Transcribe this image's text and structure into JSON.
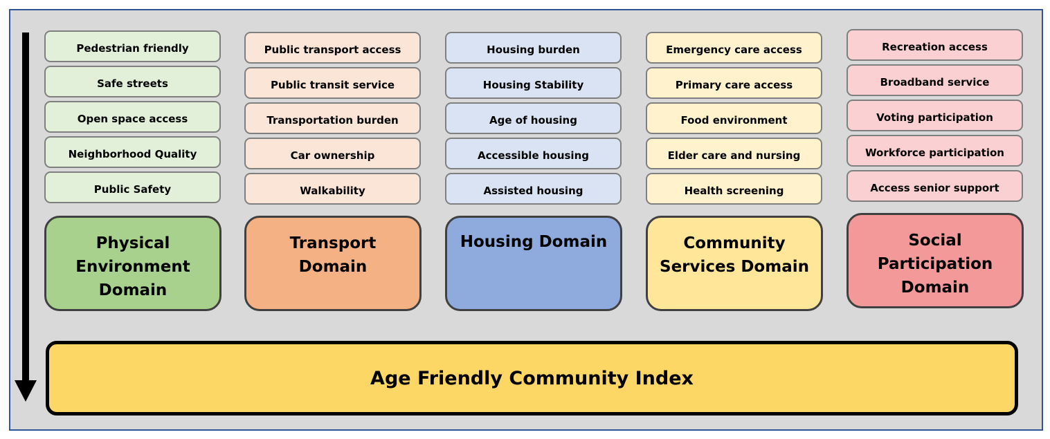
{
  "columns": [
    {
      "domain": "Physical\nEnvironment\nDomain",
      "domain_color": "#a9d18e",
      "item_color": "#e2f0d9",
      "items": [
        "Pedestrian friendly",
        "Safe streets",
        "Open space access",
        "Neighborhood Quality",
        "Public Safety"
      ]
    },
    {
      "domain": "Transport\nDomain",
      "domain_color": "#f4b183",
      "item_color": "#fbe5d6",
      "items": [
        "Public transport access",
        "Public transit service",
        "Transportation burden",
        "Car ownership",
        "Walkability"
      ]
    },
    {
      "domain": "Housing Domain",
      "domain_color": "#8faadc",
      "item_color": "#dae3f3",
      "items": [
        "Housing burden",
        "Housing Stability",
        "Age of housing",
        "Accessible housing",
        "Assisted housing"
      ]
    },
    {
      "domain": "Community\nServices Domain",
      "domain_color": "#ffe699",
      "item_color": "#fff2cc",
      "items": [
        "Emergency care access",
        "Primary care access",
        "Food environment",
        "Elder care and nursing",
        "Health screening"
      ]
    },
    {
      "domain": "Social\nParticipation\nDomain",
      "domain_color": "#f4999a",
      "item_color": "#fbd0d2",
      "items": [
        "Recreation access",
        "Broadband service",
        "Voting participation",
        "Workforce participation",
        "Access senior support"
      ]
    }
  ],
  "index": {
    "label": "Age Friendly Community Index",
    "color": "#fdd765"
  }
}
